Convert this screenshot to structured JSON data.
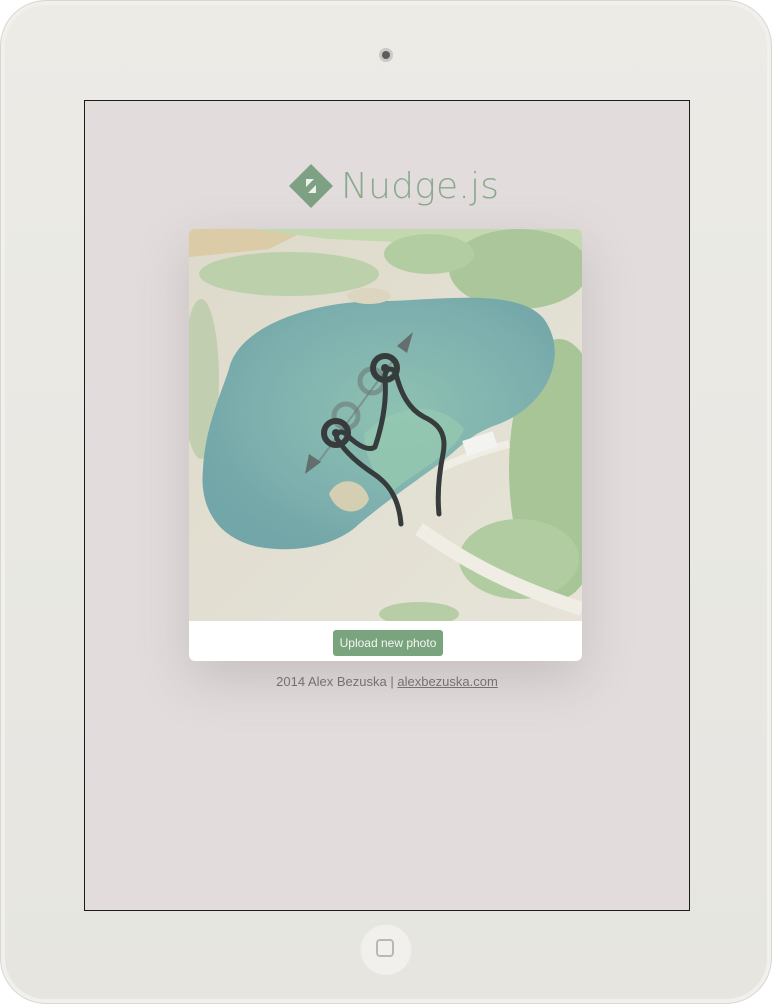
{
  "logo": {
    "text": "Nudge.js",
    "mark_icon": "nudge-diamond-icon",
    "color": "#8aa98d"
  },
  "photo": {
    "description_icon": "pinch-zoom-gesture-icon"
  },
  "upload": {
    "label": "Upload new photo",
    "color": "#7aa47e"
  },
  "footer": {
    "prefix": "2014 Alex Bezuska | ",
    "link_text": "alexbezuska.com"
  },
  "device": {
    "camera_icon": "camera-icon",
    "home_icon": "home-button-icon"
  }
}
